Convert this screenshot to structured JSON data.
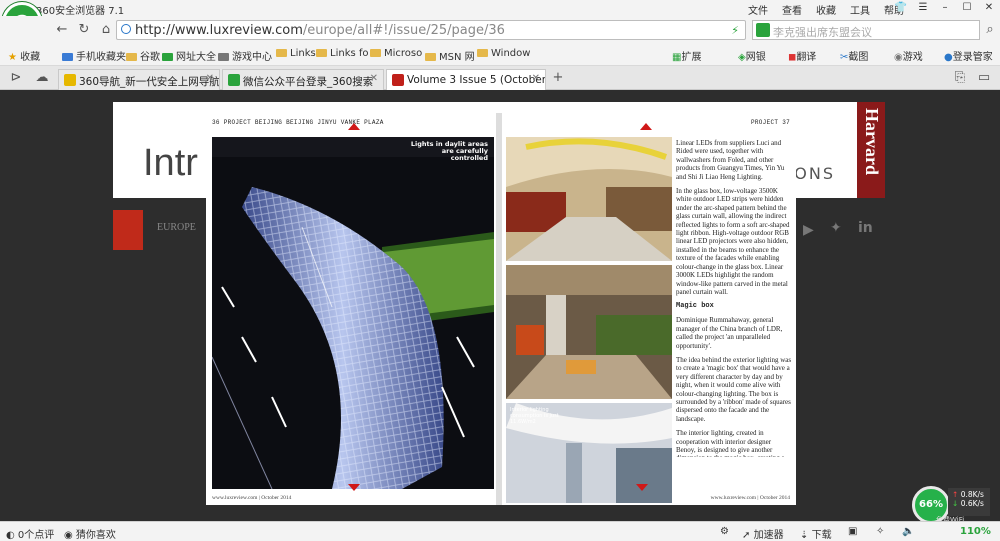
{
  "window": {
    "title": "360安全浏览器 7.1",
    "menus": [
      "文件",
      "查看",
      "收藏",
      "工具",
      "帮助"
    ]
  },
  "nav": {
    "url_host": "http://www.luxreview.com",
    "url_path": "/europe/all#!/issue/25/page/36",
    "search_placeholder": "李克强出席东盟会议"
  },
  "bookmarks": [
    "收藏",
    "手机收藏夹",
    "谷歌",
    "网址大全",
    "游戏中心",
    "Links",
    "Links fo",
    "Microso",
    "MSN 网",
    "Window"
  ],
  "toolbar_right": [
    "扩展",
    "网银",
    "翻译",
    "截图",
    "游戏",
    "登录管家"
  ],
  "tabs": [
    {
      "label": "360导航_新一代安全上网导航",
      "active": false,
      "color": "#2aa33c"
    },
    {
      "label": "微信公众平台登录_360搜索",
      "active": false,
      "color": "#2aa33c"
    },
    {
      "label": "Volume 3 Issue 5 (October",
      "active": true,
      "color": "#c0201a"
    }
  ],
  "background_site": {
    "banner_text": "Intr",
    "banner_side": "ONS",
    "harvard": "Harvard",
    "section": "EUROPE"
  },
  "magazine": {
    "left_header": "36 PROJECT BEIJING BEIJING JINYU VANKE PLAZA",
    "right_header": "PROJECT 37",
    "left_footer": "www.luxreview.com | October 2014",
    "right_footer": "www.luxreview.com | October 2014",
    "photo_caption_1": "Lights in daylit areas are carefully controlled",
    "photo_caption_2": "Interior lighting consumption is just 11.6W/m2",
    "col_top": [
      "Linear LEDs from suppliers Luci and Rided were used, together with wallwashers from Foled, and other products from Guangyu Times, Yin Yu and Shi Ji Liao Heng Lighting.",
      "In the glass box, low-voltage 3500K white outdoor LED strips were hidden under the arc-shaped pattern behind the glass curtain wall, allowing the indirect reflected lights to form a soft arc-shaped light ribbon. High-voltage outdoor RGB linear LED projectors were also hidden, installed in the beams to enhance the texture of the facades while enabling colour-change in the glass box. Linear 3000K LEDs highlight the random window-like pattern carved in the metal panel curtain wall."
    ],
    "heading": "Magic box",
    "col_bottom": [
      "Dominique Rummahaway, general manager of the China branch of LDR, called the project 'an unparalleled opportunity'.",
      "The idea behind the exterior lighting was to create a 'magic box' that would have a very different character by day and by night, when it would come alive with colour-changing lighting. The box is surrounded by a 'ribbon' made of squares dispersed onto the facade and the landscape.",
      "The interior lighting, created in cooperation with interior designer Benoy, is designed to give another dimension to the magic box, creating a"
    ]
  },
  "status": {
    "comments": "0个点评",
    "guess": "猜你喜欢",
    "accelerator": "加速器",
    "download": "下载",
    "zoom": "110%"
  },
  "net": {
    "percent": "66%",
    "up": "0.8K/s",
    "down": "0.6K/s",
    "wifi": "免费WiFi"
  }
}
